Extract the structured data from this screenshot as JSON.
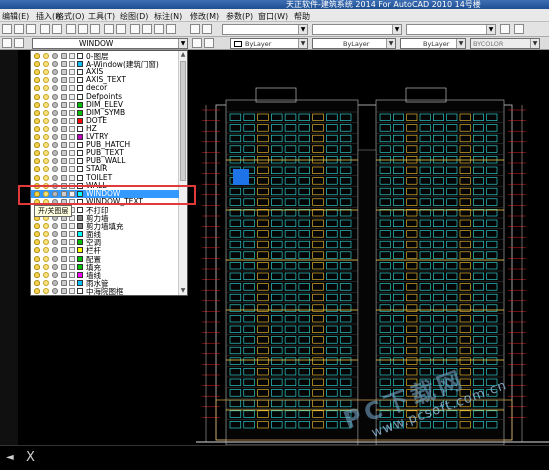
{
  "window": {
    "title": "天正软件-建筑系统 2014  For AutoCAD 2010      14号楼"
  },
  "menubar": {
    "items": [
      "编辑(E)",
      "插入(I)",
      "格式(O)",
      "工具(T)",
      "绘图(D)",
      "标注(N)",
      "修改(M)",
      "参数(P)",
      "窗口(W)",
      "帮助"
    ]
  },
  "layer_toolbar": {
    "current_layer": "WINDOW",
    "color": "ByLayer",
    "linetype": "ByLayer",
    "lineweight": "ByLayer",
    "plotstyle": "BYCOLOR"
  },
  "layers": [
    {
      "name": "0-图层",
      "color": "#ffffff"
    },
    {
      "name": "A-Window(建筑门窗)",
      "color": "#00c0ff"
    },
    {
      "name": "AXIS",
      "color": "#ffffff"
    },
    {
      "name": "AXIS_TEXT",
      "color": "#ffffff"
    },
    {
      "name": "decor",
      "color": "#ffffff"
    },
    {
      "name": "Defpoints",
      "color": "#ffffff"
    },
    {
      "name": "DIM_ELEV",
      "color": "#00c000"
    },
    {
      "name": "DIM_SYMB",
      "color": "#00c000"
    },
    {
      "name": "DOTE",
      "color": "#ff0000"
    },
    {
      "name": "HZ",
      "color": "#ffffff"
    },
    {
      "name": "LVTRY",
      "color": "#c000c0"
    },
    {
      "name": "PUB_HATCH",
      "color": "#ffffff"
    },
    {
      "name": "PUB_TEXT",
      "color": "#ffffff"
    },
    {
      "name": "PUB_WALL",
      "color": "#ffffff"
    },
    {
      "name": "STAIR",
      "color": "#ffffff"
    },
    {
      "name": "TOILET",
      "color": "#ffffff"
    },
    {
      "name": "WALL",
      "color": "#ffffff"
    },
    {
      "name": "WINDOW",
      "color": "#00ffff"
    },
    {
      "name": "WINDOW_TEXT",
      "color": "#ffffff"
    },
    {
      "name": "不打印",
      "color": "#ffffff"
    },
    {
      "name": "剪力墙",
      "color": "#808080"
    },
    {
      "name": "剪力墙填充",
      "color": "#808080"
    },
    {
      "name": "面线",
      "color": "#00ffff"
    },
    {
      "name": "空调",
      "color": "#00c000"
    },
    {
      "name": "栏杆",
      "color": "#ffff00"
    },
    {
      "name": "配置",
      "color": "#00c000"
    },
    {
      "name": "填充",
      "color": "#00c000"
    },
    {
      "name": "墙线",
      "color": "#ff00ff"
    },
    {
      "name": "雨水管",
      "color": "#00c0ff"
    },
    {
      "name": "中海院图框",
      "color": "#ffffff"
    }
  ],
  "selected_layer_index": 17,
  "tooltip": "开/关图层",
  "watermark": {
    "big": "PC下载网",
    "url": "www.pcsoft.com.cn"
  },
  "command": {
    "symbol": "X"
  }
}
